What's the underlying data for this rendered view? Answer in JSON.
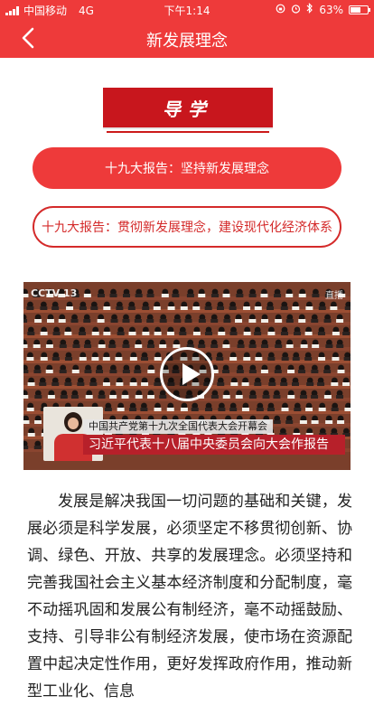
{
  "status_bar": {
    "carrier": "中国移动",
    "network": "4G",
    "time": "下午1:14",
    "battery_percent": "63%",
    "battery_level": 0.63,
    "icons": [
      "signal-icon",
      "lock-rotation-icon",
      "alarm-icon",
      "bluetooth-icon",
      "battery-icon"
    ]
  },
  "nav": {
    "title": "新发展理念",
    "back_icon": "chevron-left-icon"
  },
  "banner": {
    "label": "导学"
  },
  "reports": {
    "primary": "十九大报告：坚持新发展理念",
    "secondary": "十九大报告：贯彻新发展理念，建设现代化经济体系"
  },
  "video": {
    "logo": "CCTV 13",
    "live_tag": "直播",
    "caption_small": "中国共产党第十九次全国代表大会开幕会",
    "caption_large": "习近平代表十八届中央委员会向大会作报告",
    "play_icon": "play-icon"
  },
  "article": {
    "text": "发展是解决我国一切问题的基础和关键，发展必须是科学发展，必须坚定不移贯彻创新、协调、绿色、开放、共享的发展理念。必须坚持和完善我国社会主义基本经济制度和分配制度，毫不动摇巩固和发展公有制经济，毫不动摇鼓励、支持、引导非公有制经济发展，使市场在资源配置中起决定性作用，更好发挥政府作用，推动新型工业化、信息"
  },
  "colors": {
    "brand_red": "#ee3a3a",
    "banner_red": "#c8161d",
    "caption_red": "#b7202a"
  }
}
